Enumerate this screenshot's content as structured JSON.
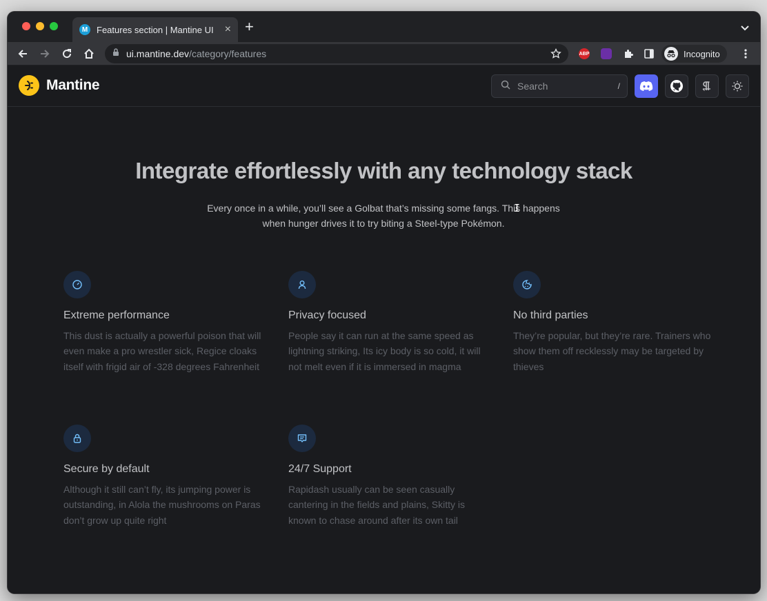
{
  "browser": {
    "tab_title": "Features section | Mantine UI",
    "tab_favicon": "M",
    "url_host": "ui.mantine.dev",
    "url_path": "/category/features",
    "ext_abp": "ABP",
    "incognito_label": "Incognito"
  },
  "header": {
    "logo_text": "Mantine",
    "search_placeholder": "Search",
    "search_shortcut": "/"
  },
  "hero": {
    "title": "Integrate effortlessly with any technology stack",
    "description": "Every once in a while, you’ll see a Golbat that’s missing some fangs. This happens when hunger drives it to try biting a Steel-type Pokémon."
  },
  "features": [
    {
      "icon": "gauge-icon",
      "title": "Extreme performance",
      "description": "This dust is actually a powerful poison that will even make a pro wrestler sick, Regice cloaks itself with frigid air of -328 degrees Fahrenheit"
    },
    {
      "icon": "user-icon",
      "title": "Privacy focused",
      "description": "People say it can run at the same speed as lightning striking, Its icy body is so cold, it will not melt even if it is immersed in magma"
    },
    {
      "icon": "cookie-icon",
      "title": "No third parties",
      "description": "They’re popular, but they’re rare. Trainers who show them off recklessly may be targeted by thieves"
    },
    {
      "icon": "lock-icon",
      "title": "Secure by default",
      "description": "Although it still can’t fly, its jumping power is outstanding, in Alola the mushrooms on Paras don’t grow up quite right"
    },
    {
      "icon": "message-icon",
      "title": "24/7 Support",
      "description": "Rapidash usually can be seen casually cantering in the fields and plains, Skitty is known to chase around after its own tail"
    }
  ],
  "colors": {
    "brand": "#fcc419",
    "discord": "#5865f2",
    "icon_accent": "#74c0fc",
    "background": "#1a1b1e"
  }
}
